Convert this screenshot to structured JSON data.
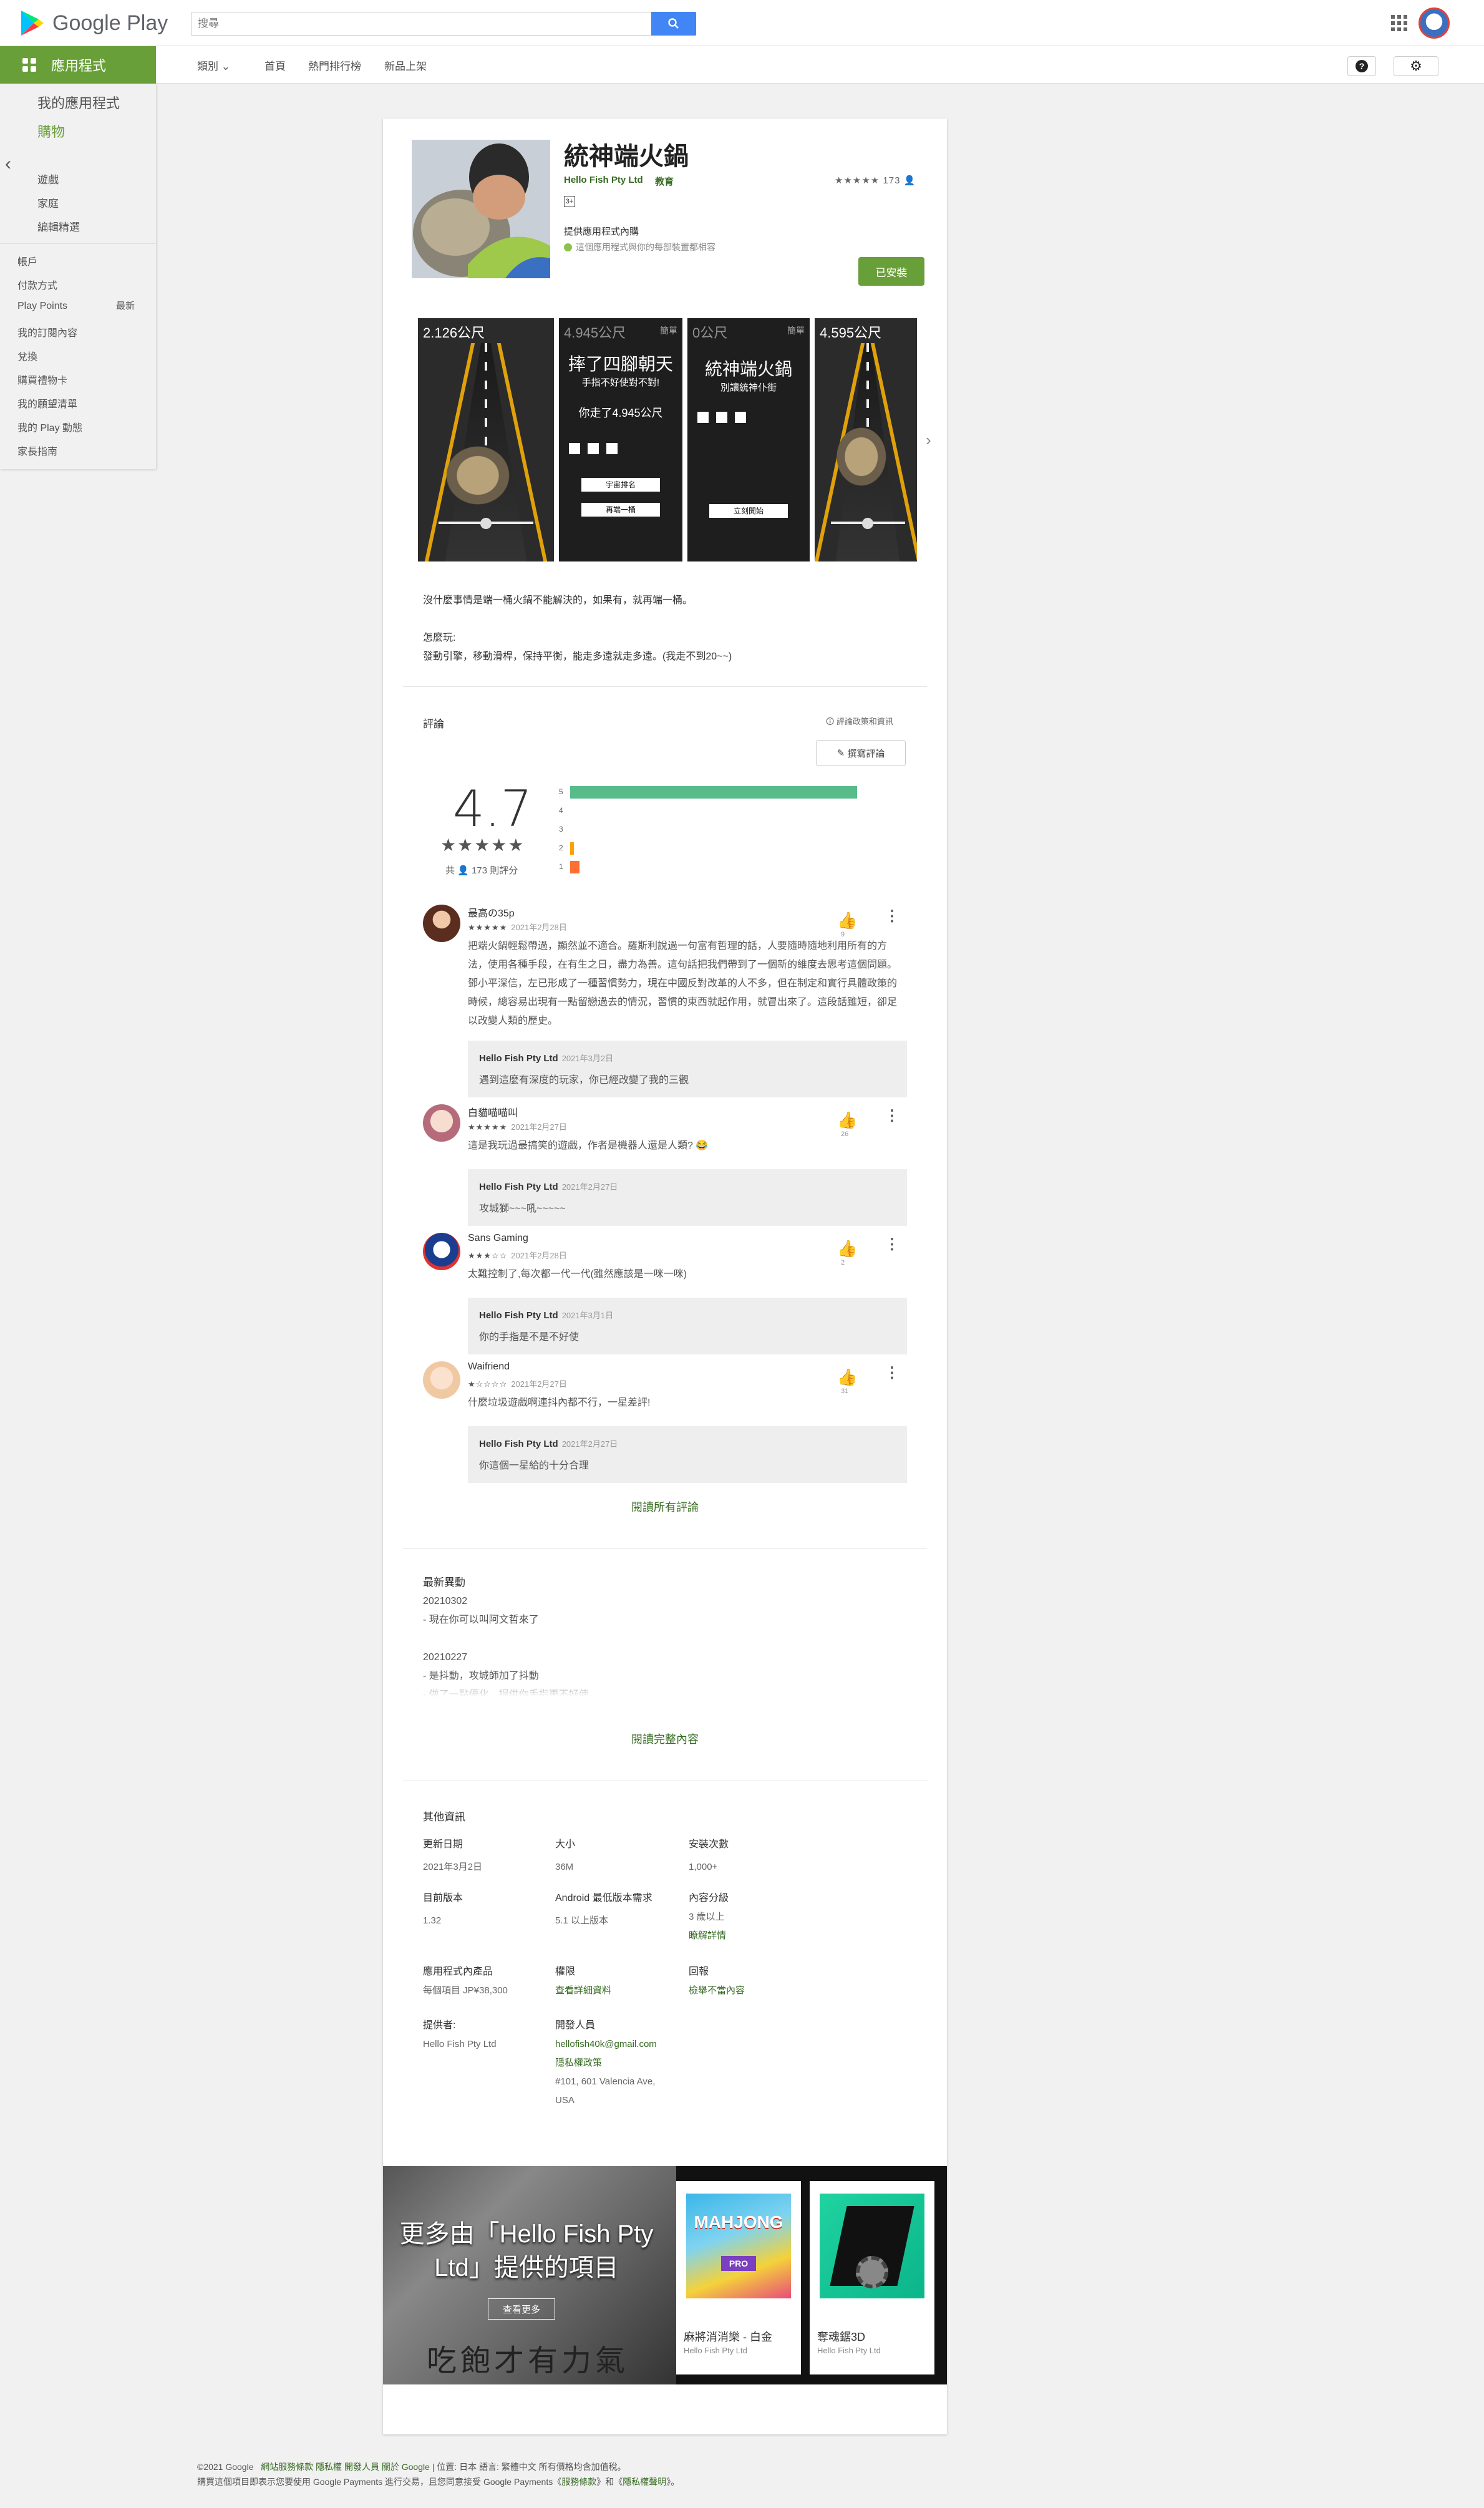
{
  "header": {
    "brand": "Google Play",
    "search_placeholder": "搜尋"
  },
  "subnav": {
    "apps_tab": "應用程式",
    "categories": "類別",
    "home": "首頁",
    "top_charts": "熱門排行榜",
    "new_releases": "新品上架"
  },
  "sidebar": {
    "my_apps": "我的應用程式",
    "shop": "購物",
    "games": "遊戲",
    "family": "家庭",
    "editors_choice": "編輯精選",
    "account": "帳戶",
    "payment": "付款方式",
    "play_points": "Play Points",
    "new_badge": "最新",
    "subscriptions": "我的訂閱內容",
    "redeem": "兌換",
    "gift_card": "購買禮物卡",
    "wishlist": "我的願望清單",
    "activity": "我的 Play 動態",
    "parent_guide": "家長指南"
  },
  "app": {
    "title": "統神端火鍋",
    "developer": "Hello Fish Pty Ltd",
    "category": "教育",
    "rating_count_mini": "173",
    "pegi": "3+",
    "iap": "提供應用程式內購",
    "compat": "這個應用程式與你的每部裝置都相容",
    "installed_label": "已安裝"
  },
  "screenshots": [
    {
      "distance": "2.126公尺"
    },
    {
      "distance": "4.945公尺",
      "tag": "簡單",
      "title": "摔了四腳朝天",
      "sub": "手指不好使對不對!",
      "result": "你走了4.945公尺",
      "btn1": "宇宙排名",
      "btn2": "再端一桶"
    },
    {
      "distance": "0公尺",
      "tag": "簡單",
      "title": "統神端火鍋",
      "sub": "別讓統神仆街",
      "btn1": "立刻開始"
    },
    {
      "distance": "4.595公尺"
    }
  ],
  "description": {
    "line1": "沒什麼事情是端一桶火鍋不能解決的，如果有，就再端一桶。",
    "line2": "怎麼玩:",
    "line3": "發動引擎，移動滑桿，保持平衡，能走多遠就走多遠。(我走不到20~~)"
  },
  "reviews": {
    "title": "評論",
    "policy": "評論政策和資訊",
    "write": "撰寫評論",
    "score": "4.7",
    "stars": "★★★★★",
    "total": "共 👤 173 則評分",
    "histogram": [
      {
        "star": "5",
        "fraction": 0.92,
        "color": "#57bb8a"
      },
      {
        "star": "4",
        "fraction": 0.0,
        "color": "#9ace6a"
      },
      {
        "star": "3",
        "fraction": 0.0,
        "color": "#ffcf02"
      },
      {
        "star": "2",
        "fraction": 0.01,
        "color": "#ff9f02"
      },
      {
        "star": "1",
        "fraction": 0.03,
        "color": "#ff6f31"
      }
    ],
    "items": [
      {
        "name": "最高の35p",
        "stars": "★★★★★",
        "date": "2021年2月28日",
        "likes": "9",
        "text": "把端火鍋輕鬆帶過，顯然並不適合。羅斯利說過一句富有哲理的話，人要隨時隨地利用所有的方法，使用各種手段，在有生之日，盡力為善。這句話把我們帶到了一個新的維度去思考這個問題。鄧小平深信，左已形成了一種習慣勢力，現在中國反對改革的人不多，但在制定和實行具體政策的時候，總容易出現有一點留戀過去的情況，習慣的東西就起作用，就冒出來了。這段話雖短，卻足以改變人類的歷史。",
        "reply_dev": "Hello Fish Pty Ltd",
        "reply_date": "2021年3月2日",
        "reply_text": "遇到這麼有深度的玩家，你已經改變了我的三觀"
      },
      {
        "name": "白貓喵喵叫",
        "stars": "★★★★★",
        "date": "2021年2月27日",
        "likes": "26",
        "text": "這是我玩過最搞笑的遊戲，作者是機器人還是人類? 😂",
        "reply_dev": "Hello Fish Pty Ltd",
        "reply_date": "2021年2月27日",
        "reply_text": "攻城獅~~~吼~~~~~"
      },
      {
        "name": "Sans Gaming",
        "stars": "★★★☆☆",
        "date": "2021年2月28日",
        "likes": "2",
        "text": "太難控制了,每次都一代一代(雖然應該是一咪一咪)",
        "reply_dev": "Hello Fish Pty Ltd",
        "reply_date": "2021年3月1日",
        "reply_text": "你的手指是不是不好使"
      },
      {
        "name": "Waifriend",
        "stars": "★☆☆☆☆",
        "date": "2021年2月27日",
        "likes": "31",
        "text": "什麼垃圾遊戲啊連抖內都不行，一星差評!",
        "reply_dev": "Hello Fish Pty Ltd",
        "reply_date": "2021年2月27日",
        "reply_text": "你這個一星給的十分合理"
      }
    ],
    "all_reviews": "閱讀所有評論"
  },
  "whats_new": {
    "title": "最新異動",
    "lines": [
      "20210302",
      "- 現在你可以叫阿文哲來了",
      "",
      "20210227",
      "- 是抖動，攻城師加了抖動",
      "- 做了一點優化，提供你手指更不好使"
    ],
    "read_more": "閱讀完整內容"
  },
  "info": {
    "title": "其他資訊",
    "updated_label": "更新日期",
    "updated": "2021年3月2日",
    "size_label": "大小",
    "size": "36M",
    "installs_label": "安裝次數",
    "installs": "1,000+",
    "version_label": "目前版本",
    "version": "1.32",
    "android_label": "Android 最低版本需求",
    "android": "5.1 以上版本",
    "rating_label": "內容分級",
    "rating": "3 歲以上",
    "rating_link": "瞭解詳情",
    "iap_label": "應用程式內產品",
    "iap": "每個項目 JP¥38,300",
    "perm_label": "權限",
    "perm": "查看詳細資料",
    "report_label": "回報",
    "report": "檢舉不當內容",
    "offered_label": "提供者:",
    "offered": "Hello Fish Pty Ltd",
    "dev_label": "開發人員",
    "dev_email": "hellofish40k@gmail.com",
    "dev_privacy": "隱私權政策",
    "dev_addr1": "#101, 601 Valencia Ave,",
    "dev_addr2": "USA"
  },
  "more_by": {
    "title": "更多由「Hello Fish Pty Ltd」提供的項目",
    "see_more": "查看更多",
    "calligraphy": "吃飽才有力氣",
    "apps": [
      {
        "name": "麻將消消樂 - 白金",
        "dev": "Hello Fish Pty Ltd"
      },
      {
        "name": "奪魂鋸3D",
        "dev": "Hello Fish Pty Ltd"
      }
    ]
  },
  "footer": {
    "line1_prefix": "©2021 Google",
    "tos": "網站服務條款",
    "privacy": "隱私權",
    "developers": "開發人員",
    "about": "關於 Google",
    "line1_suffix": "| 位置: 日本 語言: 繁體中文   所有價格均含加值稅。",
    "line2_prefix": "購買這個項目即表示您要使用 Google Payments 進行交易，且您同意接受 Google Payments《",
    "tos2": "服務條款",
    "line2_mid": "》和《",
    "privacy2": "隱私權聲明",
    "line2_suffix": "》。"
  }
}
